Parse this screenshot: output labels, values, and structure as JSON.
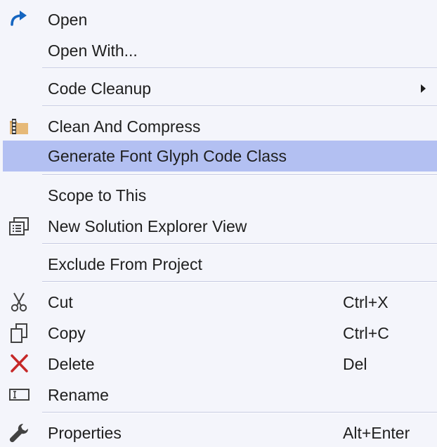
{
  "menu": {
    "items": [
      {
        "label": "Open",
        "icon": "redo-arrow-icon",
        "shortcut": ""
      },
      {
        "label": "Open With...",
        "icon": "",
        "shortcut": ""
      },
      {
        "label": "Code Cleanup",
        "icon": "",
        "shortcut": "",
        "submenu": true
      },
      {
        "label": "Clean And Compress",
        "icon": "folder-archive-icon",
        "shortcut": ""
      },
      {
        "label": "Generate Font Glyph Code Class",
        "icon": "",
        "shortcut": "",
        "highlighted": true
      },
      {
        "label": "Scope to This",
        "icon": "",
        "shortcut": ""
      },
      {
        "label": "New Solution Explorer View",
        "icon": "new-window-list-icon",
        "shortcut": ""
      },
      {
        "label": "Exclude From Project",
        "icon": "",
        "shortcut": ""
      },
      {
        "label": "Cut",
        "icon": "scissors-icon",
        "shortcut": "Ctrl+X"
      },
      {
        "label": "Copy",
        "icon": "copy-icon",
        "shortcut": "Ctrl+C"
      },
      {
        "label": "Delete",
        "icon": "delete-x-icon",
        "shortcut": "Del"
      },
      {
        "label": "Rename",
        "icon": "rename-textbox-icon",
        "shortcut": ""
      },
      {
        "label": "Properties",
        "icon": "wrench-icon",
        "shortcut": "Alt+Enter"
      }
    ]
  },
  "colors": {
    "background": "#f4f5fb",
    "highlight": "#b3c0f2",
    "separator": "#c6cae2",
    "icon_blue": "#1565c0",
    "delete_red": "#c62828",
    "icon_gray": "#424242"
  }
}
